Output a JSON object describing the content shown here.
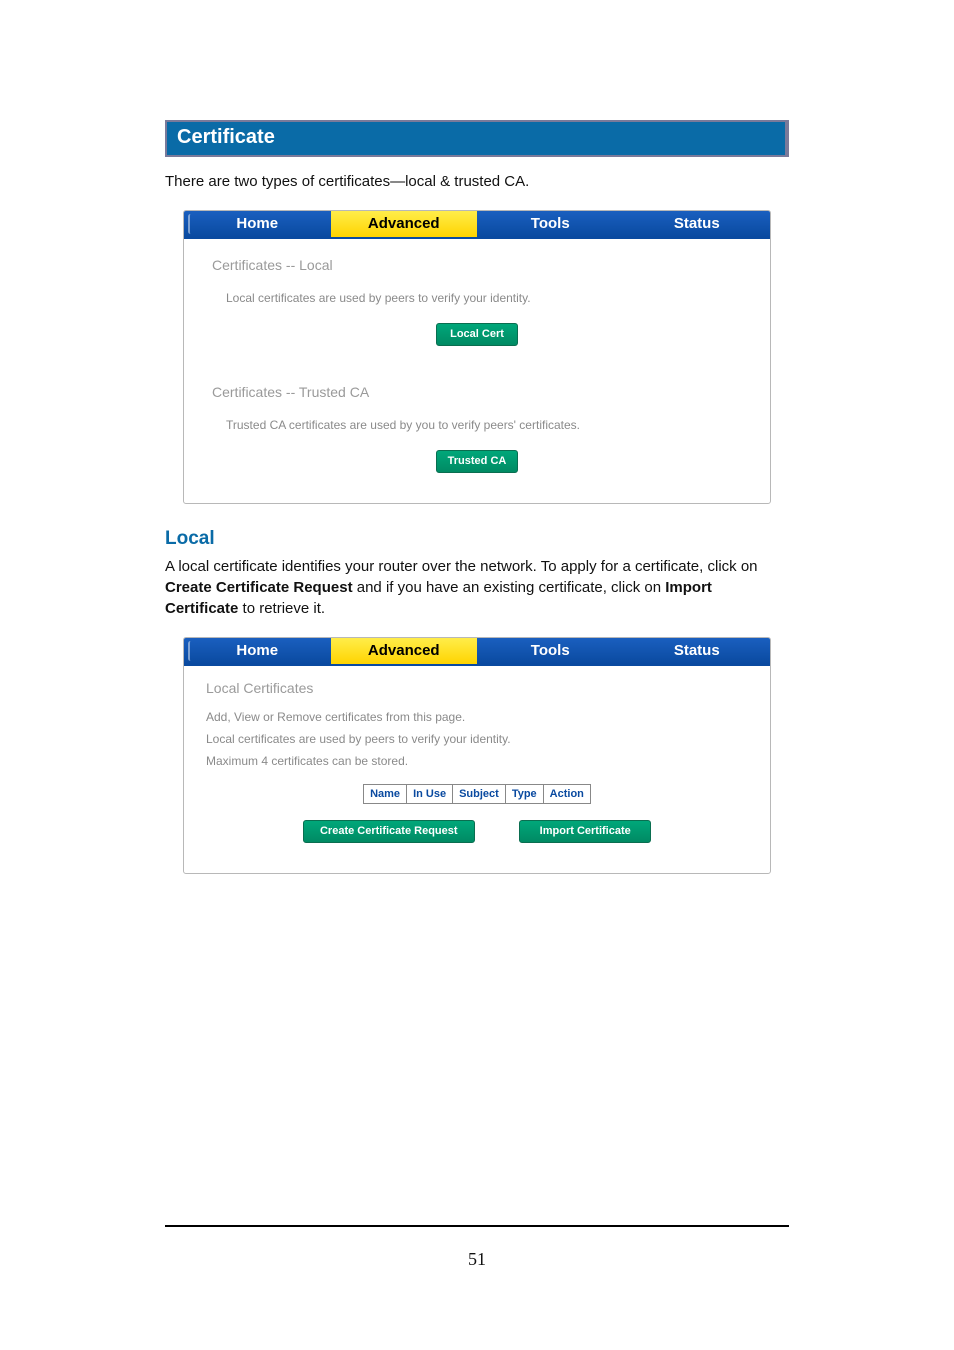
{
  "section_title": "Certificate",
  "intro_text": "There are two types of certificates—local & trusted CA.",
  "tabs": {
    "home": "Home",
    "advanced": "Advanced",
    "tools": "Tools",
    "status": "Status"
  },
  "panel1": {
    "heading_local": "Certificates -- Local",
    "sub_local": "Local certificates are used by peers to verify your identity.",
    "btn_local": "Local Cert",
    "heading_trusted": "Certificates -- Trusted CA",
    "sub_trusted": "Trusted CA certificates are used by you to verify peers' certificates.",
    "btn_trusted": "Trusted CA"
  },
  "local_section": {
    "title": "Local",
    "para_pre": "A local certificate identifies your router over the network. To apply for a certificate, click on ",
    "bold1": "Create Certificate Request",
    "para_mid": " and if you have an existing certificate, click on ",
    "bold2": "Import Certificate",
    "para_post": " to retrieve it."
  },
  "panel2": {
    "heading": "Local Certificates",
    "line1": "Add, View or Remove certificates from this page.",
    "line2": "Local certificates are used by peers to verify your identity.",
    "line3": "Maximum 4 certificates can be stored.",
    "cols": {
      "name": "Name",
      "inuse": "In Use",
      "subject": "Subject",
      "type": "Type",
      "action": "Action"
    },
    "btn_create": "Create Certificate Request",
    "btn_import": "Import Certificate"
  },
  "page_number": "51"
}
